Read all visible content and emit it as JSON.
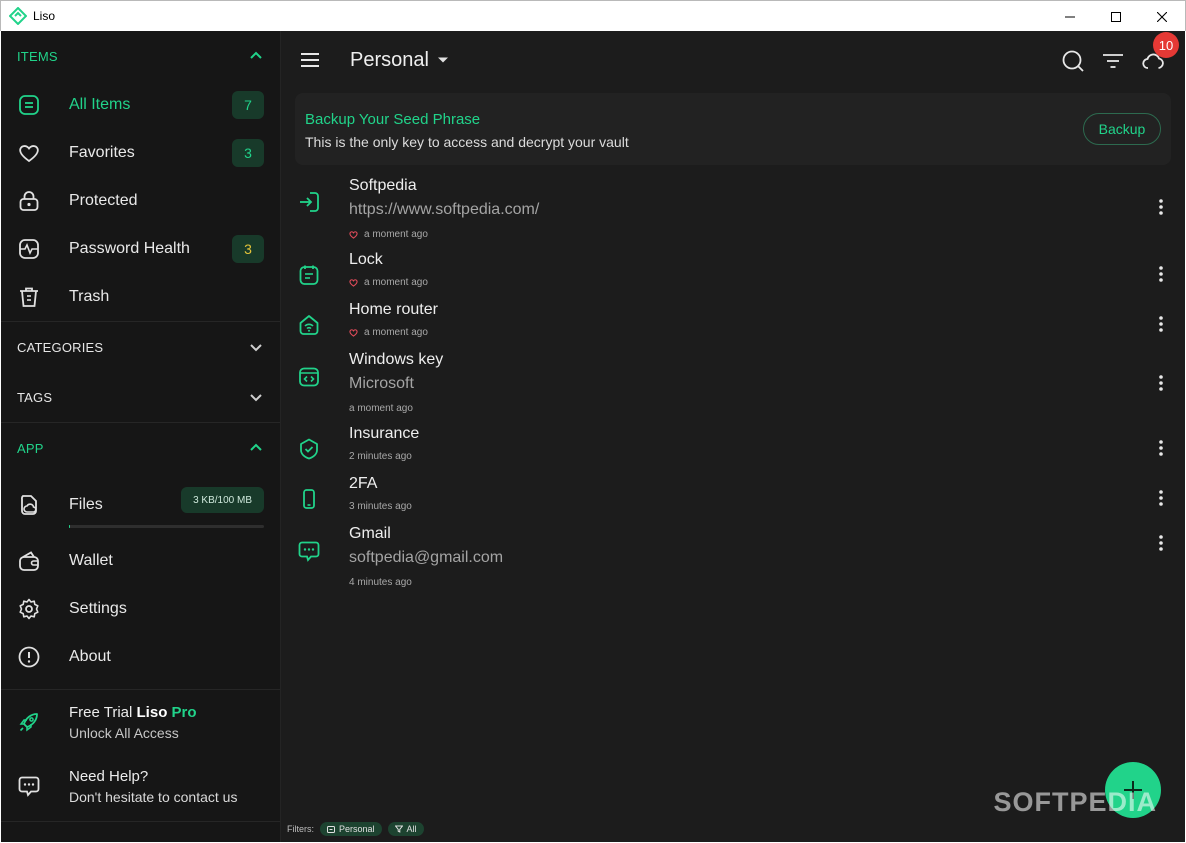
{
  "window": {
    "title": "Liso"
  },
  "sidebar": {
    "items_header": "ITEMS",
    "items": [
      {
        "label": "All Items",
        "badge": "7",
        "icon": "all-items-icon"
      },
      {
        "label": "Favorites",
        "badge": "3",
        "icon": "heart-icon"
      },
      {
        "label": "Protected",
        "badge": "",
        "icon": "lock-icon"
      },
      {
        "label": "Password Health",
        "badge": "3",
        "icon": "health-icon"
      },
      {
        "label": "Trash",
        "badge": "",
        "icon": "trash-icon"
      }
    ],
    "categories_header": "CATEGORIES",
    "tags_header": "TAGS",
    "app_header": "APP",
    "files": {
      "label": "Files",
      "storage": "3 KB/100 MB",
      "usage_fraction": 3e-05
    },
    "app_items": [
      {
        "label": "Wallet",
        "icon": "wallet-icon"
      },
      {
        "label": "Settings",
        "icon": "gear-icon"
      },
      {
        "label": "About",
        "icon": "info-icon"
      }
    ],
    "promo": {
      "prefix": "Free Trial ",
      "brand": "Liso",
      "pro": " Pro",
      "subtitle": "Unlock All Access"
    },
    "help": {
      "title": "Need Help?",
      "subtitle": "Don't hesitate to contact us"
    }
  },
  "topbar": {
    "vault": "Personal",
    "notifications": "10"
  },
  "banner": {
    "title": "Backup Your Seed Phrase",
    "subtitle": "This is the only key to access and decrypt your vault",
    "button": "Backup"
  },
  "list": [
    {
      "title": "Softpedia",
      "subtitle": "https://www.softpedia.com/",
      "time": "a moment ago",
      "favorite": true,
      "icon": "login-icon"
    },
    {
      "title": "Lock",
      "subtitle": "",
      "time": "a moment ago",
      "favorite": true,
      "icon": "note-icon"
    },
    {
      "title": "Home router",
      "subtitle": "",
      "time": "a moment ago",
      "favorite": true,
      "icon": "wifi-router-icon"
    },
    {
      "title": "Windows key",
      "subtitle": "Microsoft",
      "time": "a moment ago",
      "favorite": false,
      "icon": "software-license-icon"
    },
    {
      "title": "Insurance",
      "subtitle": "",
      "time": "2 minutes ago",
      "favorite": false,
      "icon": "shield-check-icon"
    },
    {
      "title": "2FA",
      "subtitle": "",
      "time": "3 minutes ago",
      "favorite": false,
      "icon": "phone-icon"
    },
    {
      "title": "Gmail",
      "subtitle": "softpedia@gmail.com",
      "time": "4 minutes ago",
      "favorite": false,
      "icon": "chat-icon"
    }
  ],
  "filters": {
    "label": "Filters:",
    "vault": "Personal",
    "type": "All"
  },
  "watermark": "SOFTPEDIA",
  "colors": {
    "accent": "#21d38a",
    "background": "#1c1c1c",
    "sidebar": "#161616",
    "badge_bg": "#183a2a",
    "notification": "#e53935"
  }
}
